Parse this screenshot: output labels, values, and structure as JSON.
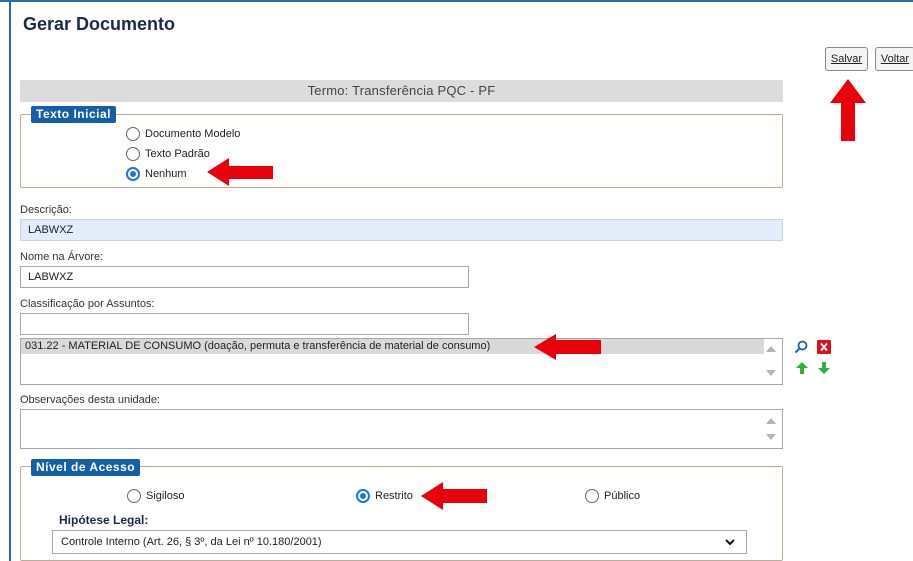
{
  "header": {
    "title": "Gerar Documento"
  },
  "toolbar": {
    "save_label": "Salvar",
    "back_label": "Voltar"
  },
  "termo": {
    "label": "Termo: Transferência PQC - PF"
  },
  "texto_inicial": {
    "legend": "Texto Inicial",
    "options": [
      "Documento Modelo",
      "Texto Padrão",
      "Nenhum"
    ],
    "selected": "Nenhum"
  },
  "descricao": {
    "label": "Descrição:",
    "value": "LABWXZ"
  },
  "nome_arvore": {
    "label": "Nome na Árvore:",
    "value": "LABWXZ"
  },
  "classificacao": {
    "label": "Classificação por Assuntos:",
    "search_value": "",
    "items": [
      "031.22 - MATERIAL DE CONSUMO (doação, permuta e transferência de material de consumo)"
    ]
  },
  "observacoes": {
    "label": "Observações desta unidade:",
    "value": ""
  },
  "nivel_acesso": {
    "legend": "Nível de Acesso",
    "options": [
      "Sigiloso",
      "Restrito",
      "Público"
    ],
    "selected": "Restrito"
  },
  "hipotese": {
    "label": "Hipótese Legal:",
    "selected": "Controle Interno (Art. 26, § 3º, da Lei nº 10.180/2001)"
  },
  "icons": {
    "search": "magnifier-icon",
    "remove": "red-x-icon",
    "move_up": "green-up-arrow-icon",
    "move_down": "green-down-arrow-icon"
  },
  "colors": {
    "accent": "#155fa8",
    "arrow": "#e8000b",
    "legend_border": "#c9a889"
  }
}
